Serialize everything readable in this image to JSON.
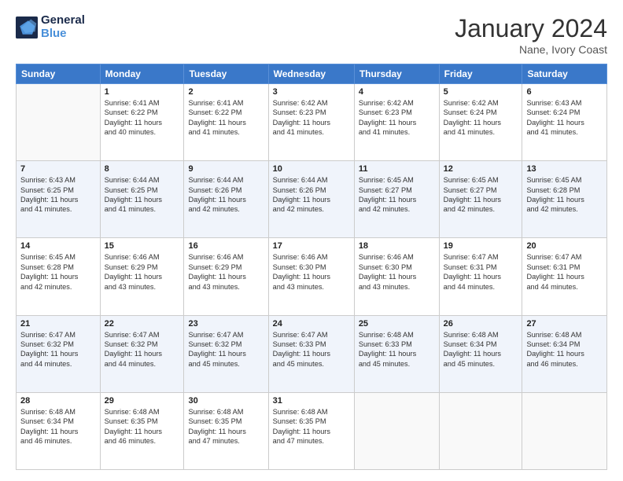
{
  "logo": {
    "text_general": "General",
    "text_blue": "Blue"
  },
  "title": "January 2024",
  "location": "Nane, Ivory Coast",
  "days_of_week": [
    "Sunday",
    "Monday",
    "Tuesday",
    "Wednesday",
    "Thursday",
    "Friday",
    "Saturday"
  ],
  "weeks": [
    [
      {
        "day": "",
        "info": ""
      },
      {
        "day": "1",
        "info": "Sunrise: 6:41 AM\nSunset: 6:22 PM\nDaylight: 11 hours\nand 40 minutes."
      },
      {
        "day": "2",
        "info": "Sunrise: 6:41 AM\nSunset: 6:22 PM\nDaylight: 11 hours\nand 41 minutes."
      },
      {
        "day": "3",
        "info": "Sunrise: 6:42 AM\nSunset: 6:23 PM\nDaylight: 11 hours\nand 41 minutes."
      },
      {
        "day": "4",
        "info": "Sunrise: 6:42 AM\nSunset: 6:23 PM\nDaylight: 11 hours\nand 41 minutes."
      },
      {
        "day": "5",
        "info": "Sunrise: 6:42 AM\nSunset: 6:24 PM\nDaylight: 11 hours\nand 41 minutes."
      },
      {
        "day": "6",
        "info": "Sunrise: 6:43 AM\nSunset: 6:24 PM\nDaylight: 11 hours\nand 41 minutes."
      }
    ],
    [
      {
        "day": "7",
        "info": "Sunrise: 6:43 AM\nSunset: 6:25 PM\nDaylight: 11 hours\nand 41 minutes."
      },
      {
        "day": "8",
        "info": "Sunrise: 6:44 AM\nSunset: 6:25 PM\nDaylight: 11 hours\nand 41 minutes."
      },
      {
        "day": "9",
        "info": "Sunrise: 6:44 AM\nSunset: 6:26 PM\nDaylight: 11 hours\nand 42 minutes."
      },
      {
        "day": "10",
        "info": "Sunrise: 6:44 AM\nSunset: 6:26 PM\nDaylight: 11 hours\nand 42 minutes."
      },
      {
        "day": "11",
        "info": "Sunrise: 6:45 AM\nSunset: 6:27 PM\nDaylight: 11 hours\nand 42 minutes."
      },
      {
        "day": "12",
        "info": "Sunrise: 6:45 AM\nSunset: 6:27 PM\nDaylight: 11 hours\nand 42 minutes."
      },
      {
        "day": "13",
        "info": "Sunrise: 6:45 AM\nSunset: 6:28 PM\nDaylight: 11 hours\nand 42 minutes."
      }
    ],
    [
      {
        "day": "14",
        "info": "Sunrise: 6:45 AM\nSunset: 6:28 PM\nDaylight: 11 hours\nand 42 minutes."
      },
      {
        "day": "15",
        "info": "Sunrise: 6:46 AM\nSunset: 6:29 PM\nDaylight: 11 hours\nand 43 minutes."
      },
      {
        "day": "16",
        "info": "Sunrise: 6:46 AM\nSunset: 6:29 PM\nDaylight: 11 hours\nand 43 minutes."
      },
      {
        "day": "17",
        "info": "Sunrise: 6:46 AM\nSunset: 6:30 PM\nDaylight: 11 hours\nand 43 minutes."
      },
      {
        "day": "18",
        "info": "Sunrise: 6:46 AM\nSunset: 6:30 PM\nDaylight: 11 hours\nand 43 minutes."
      },
      {
        "day": "19",
        "info": "Sunrise: 6:47 AM\nSunset: 6:31 PM\nDaylight: 11 hours\nand 44 minutes."
      },
      {
        "day": "20",
        "info": "Sunrise: 6:47 AM\nSunset: 6:31 PM\nDaylight: 11 hours\nand 44 minutes."
      }
    ],
    [
      {
        "day": "21",
        "info": "Sunrise: 6:47 AM\nSunset: 6:32 PM\nDaylight: 11 hours\nand 44 minutes."
      },
      {
        "day": "22",
        "info": "Sunrise: 6:47 AM\nSunset: 6:32 PM\nDaylight: 11 hours\nand 44 minutes."
      },
      {
        "day": "23",
        "info": "Sunrise: 6:47 AM\nSunset: 6:32 PM\nDaylight: 11 hours\nand 45 minutes."
      },
      {
        "day": "24",
        "info": "Sunrise: 6:47 AM\nSunset: 6:33 PM\nDaylight: 11 hours\nand 45 minutes."
      },
      {
        "day": "25",
        "info": "Sunrise: 6:48 AM\nSunset: 6:33 PM\nDaylight: 11 hours\nand 45 minutes."
      },
      {
        "day": "26",
        "info": "Sunrise: 6:48 AM\nSunset: 6:34 PM\nDaylight: 11 hours\nand 45 minutes."
      },
      {
        "day": "27",
        "info": "Sunrise: 6:48 AM\nSunset: 6:34 PM\nDaylight: 11 hours\nand 46 minutes."
      }
    ],
    [
      {
        "day": "28",
        "info": "Sunrise: 6:48 AM\nSunset: 6:34 PM\nDaylight: 11 hours\nand 46 minutes."
      },
      {
        "day": "29",
        "info": "Sunrise: 6:48 AM\nSunset: 6:35 PM\nDaylight: 11 hours\nand 46 minutes."
      },
      {
        "day": "30",
        "info": "Sunrise: 6:48 AM\nSunset: 6:35 PM\nDaylight: 11 hours\nand 47 minutes."
      },
      {
        "day": "31",
        "info": "Sunrise: 6:48 AM\nSunset: 6:35 PM\nDaylight: 11 hours\nand 47 minutes."
      },
      {
        "day": "",
        "info": ""
      },
      {
        "day": "",
        "info": ""
      },
      {
        "day": "",
        "info": ""
      }
    ]
  ]
}
